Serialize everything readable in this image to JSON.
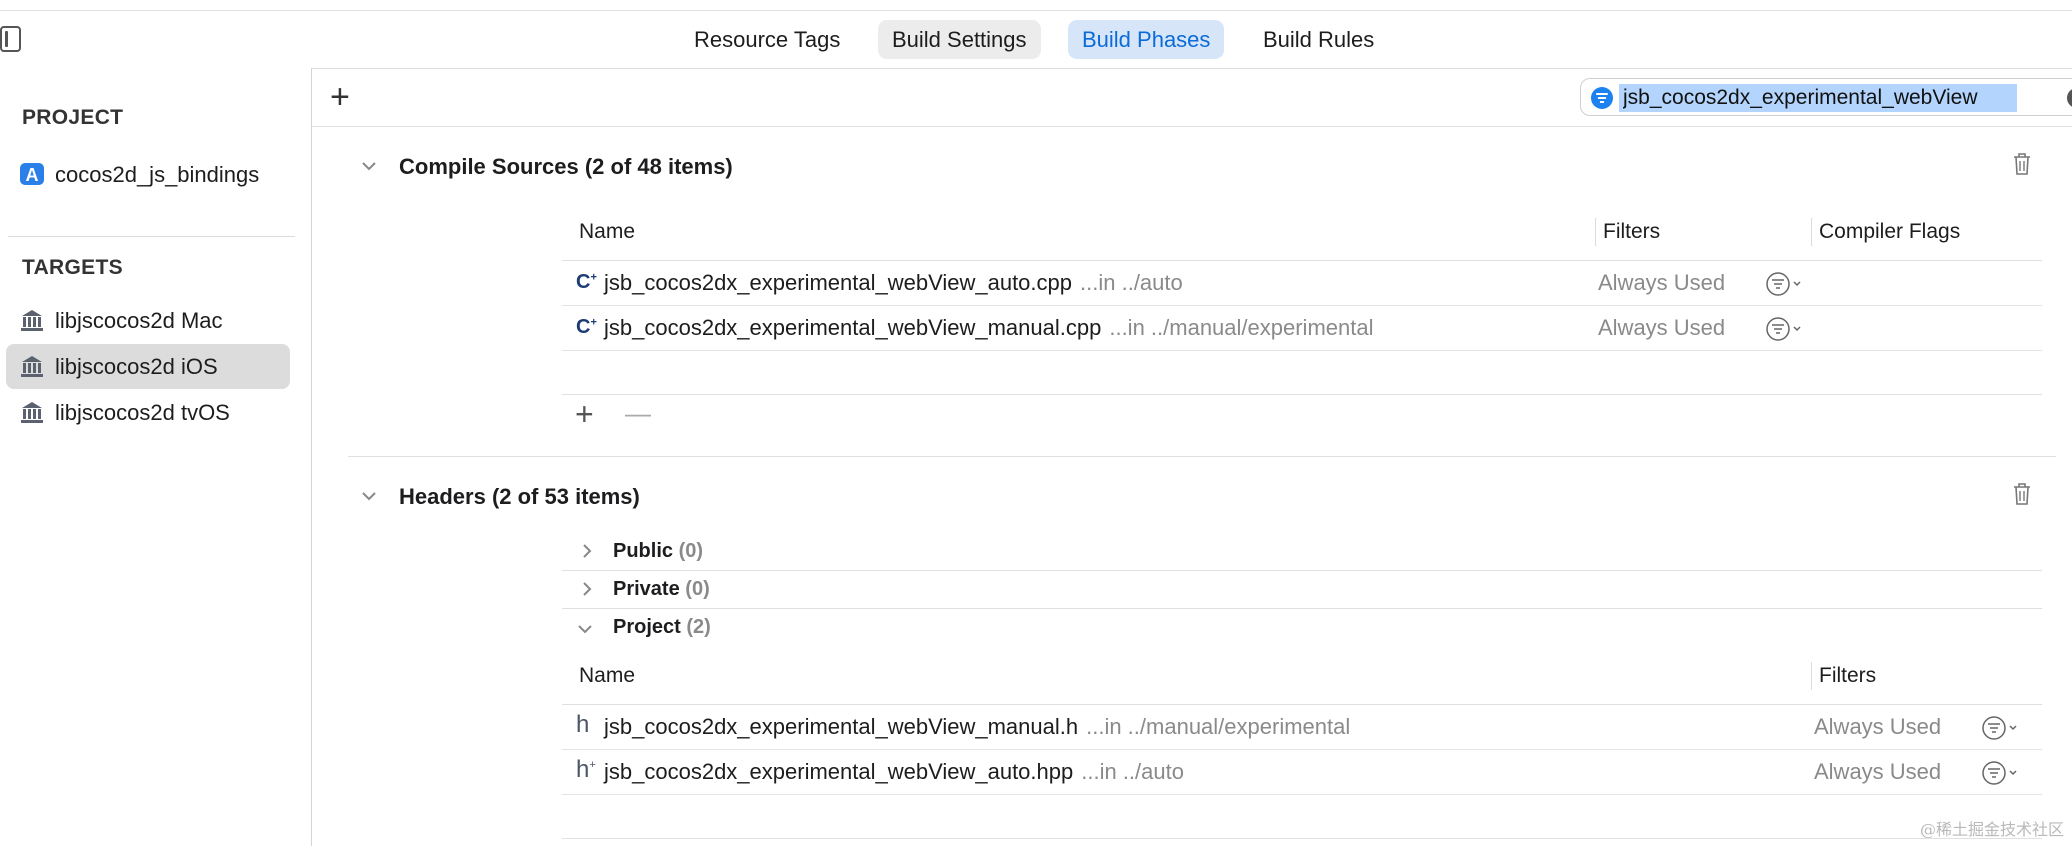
{
  "tabs": [
    {
      "label": "Resource Tags"
    },
    {
      "label": "Build Settings"
    },
    {
      "label": "Build Phases"
    },
    {
      "label": "Build Rules"
    }
  ],
  "sidebar": {
    "project_header": "PROJECT",
    "project_item": "cocos2d_js_bindings",
    "targets_header": "TARGETS",
    "targets": [
      {
        "label": "libjscocos2d Mac"
      },
      {
        "label": "libjscocos2d iOS",
        "selected": true
      },
      {
        "label": "libjscocos2d tvOS"
      }
    ]
  },
  "toolbar": {
    "add_label": "+",
    "search_value": "jsb_cocos2dx_experimental_webView"
  },
  "compile_sources": {
    "title": "Compile Sources (2 of 48 items)",
    "columns": {
      "name": "Name",
      "filters": "Filters",
      "flags": "Compiler Flags"
    },
    "rows": [
      {
        "icon": "C",
        "name": "jsb_cocos2dx_experimental_webView_auto.cpp",
        "path": "...in ../auto",
        "filter": "Always Used"
      },
      {
        "icon": "C",
        "name": "jsb_cocos2dx_experimental_webView_manual.cpp",
        "path": "...in ../manual/experimental",
        "filter": "Always Used"
      }
    ],
    "add_label": "+",
    "remove_label": "—"
  },
  "headers": {
    "title": "Headers (2 of 53 items)",
    "groups": [
      {
        "label": "Public",
        "count": "(0)"
      },
      {
        "label": "Private",
        "count": "(0)"
      },
      {
        "label": "Project",
        "count": "(2)"
      }
    ],
    "columns": {
      "name": "Name",
      "filters": "Filters"
    },
    "rows": [
      {
        "icon": "h",
        "name": "jsb_cocos2dx_experimental_webView_manual.h",
        "path": "...in ../manual/experimental",
        "filter": "Always Used"
      },
      {
        "icon": "h",
        "name": "jsb_cocos2dx_experimental_webView_auto.hpp",
        "path": "...in ../auto",
        "filter": "Always Used"
      }
    ]
  },
  "watermark": "@稀土掘金技术社区",
  "colors": {
    "accent": "#0b6bd8",
    "selected_tab_bg": "#d6e6f8",
    "secondary_text": "#8a8a8a"
  }
}
